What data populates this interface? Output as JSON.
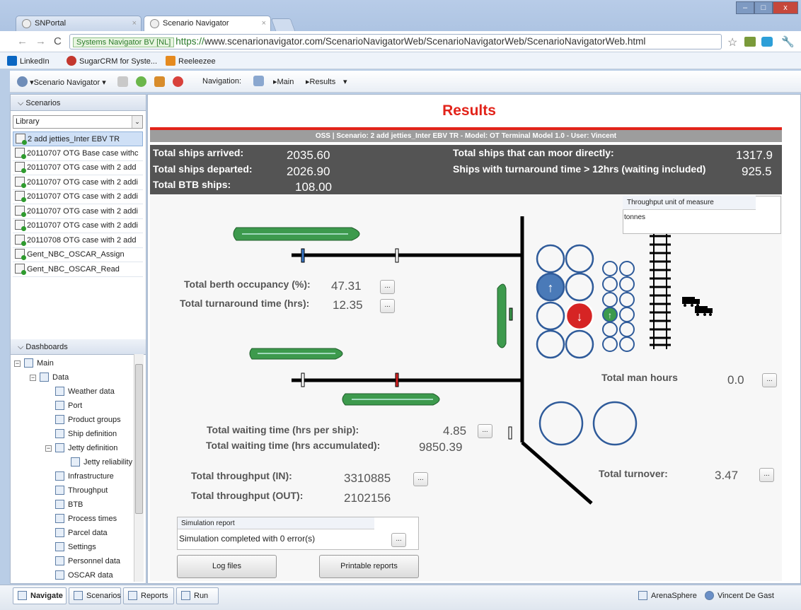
{
  "browser": {
    "tabs": [
      {
        "label": "SNPortal"
      },
      {
        "label": "Scenario Navigator"
      }
    ],
    "address": {
      "secure_label": "Systems Navigator BV [NL]",
      "scheme": "https://",
      "url": "www.scenarionavigator.com/ScenarioNavigatorWeb/ScenarioNavigatorWeb/ScenarioNavigatorWeb.html"
    },
    "bookmarks": [
      "LinkedIn",
      "SugarCRM for Syste...",
      "Reeleezee"
    ]
  },
  "app_toolbar": {
    "menu_label": "▾Scenario Navigator ▾",
    "navigation_label": "Navigation:",
    "crumbs": [
      "▸Main",
      "▸Results",
      "▾"
    ]
  },
  "scenarios_pane": {
    "header": "Scenarios",
    "library_select": "Library",
    "items": [
      "2 add jetties_Inter EBV TR",
      "20110707 OTG Base case withc",
      "20110707 OTG case with 2 add",
      "20110707 OTG case with 2 addi",
      "20110707 OTG case with 2 addi",
      "20110707 OTG case with 2 addi",
      "20110707 OTG case with 2 addi",
      "20110708 OTG case with 2 add",
      "Gent_NBC_OSCAR_Assign",
      "Gent_NBC_OSCAR_Read"
    ]
  },
  "dashboards_pane": {
    "header": "Dashboards",
    "tree": [
      {
        "label": "Main",
        "level": 0,
        "expander": "−"
      },
      {
        "label": "Data",
        "level": 1,
        "expander": "−"
      },
      {
        "label": "Weather data",
        "level": 2
      },
      {
        "label": "Port",
        "level": 2
      },
      {
        "label": "Product groups",
        "level": 2
      },
      {
        "label": "Ship definition",
        "level": 2
      },
      {
        "label": "Jetty definition",
        "level": 2,
        "expander": "−"
      },
      {
        "label": "Jetty reliability",
        "level": 3
      },
      {
        "label": "Infrastructure",
        "level": 2
      },
      {
        "label": "Throughput",
        "level": 2
      },
      {
        "label": "BTB",
        "level": 2
      },
      {
        "label": "Process times",
        "level": 2
      },
      {
        "label": "Parcel data",
        "level": 2
      },
      {
        "label": "Settings",
        "level": 2
      },
      {
        "label": "Personnel data",
        "level": 2
      },
      {
        "label": "OSCAR data",
        "level": 2
      }
    ]
  },
  "results": {
    "title": "Results",
    "subtitle": "OSS | Scenario: 2 add jetties_Inter EBV TR - Model: OT Terminal Model 1.0 - User: Vincent",
    "stats": {
      "arrived_label": "Total ships arrived:",
      "arrived": "2035.60",
      "departed_label": "Total ships departed:",
      "departed": "2026.90",
      "btb_label": "Total BTB ships:",
      "btb": "108.00",
      "moor_label": "Total ships that can moor directly:",
      "moor": "1317.9",
      "turnaround12_label": "Ships with turnaround time > 12hrs (waiting included)",
      "turnaround12": "925.5"
    },
    "throughput_uom": {
      "header": "Throughput unit of measure",
      "value": "tonnes"
    },
    "berth_occupancy_label": "Total berth occupancy (%):",
    "berth_occupancy": "47.31",
    "turnaround_label": "Total turnaround time (hrs):",
    "turnaround": "12.35",
    "man_hours_label": "Total man hours",
    "man_hours": "0.0",
    "waiting_ship_label": "Total waiting time (hrs per ship):",
    "waiting_ship": "4.85",
    "waiting_acc_label": "Total waiting time (hrs accumulated):",
    "waiting_acc": "9850.39",
    "turnover_label": "Total turnover:",
    "turnover": "3.47",
    "tp_in_label": "Total throughput (IN):",
    "tp_in": "3310885",
    "tp_out_label": "Total throughput (OUT):",
    "tp_out": "2102156",
    "dots": "...",
    "sim_report": {
      "header": "Simulation report",
      "value": "Simulation completed with 0 error(s)"
    },
    "log_files": "Log files",
    "printable_reports": "Printable reports"
  },
  "statusbar": {
    "tabs": [
      "Navigate",
      "Scenarios",
      "Reports",
      "Run"
    ],
    "right": [
      "ArenaSphere",
      "Vincent De Gast"
    ]
  },
  "colors": {
    "accent_red": "#e2231a",
    "tank_blue": "#4a7ab8",
    "ship_green": "#3d9a4d"
  }
}
